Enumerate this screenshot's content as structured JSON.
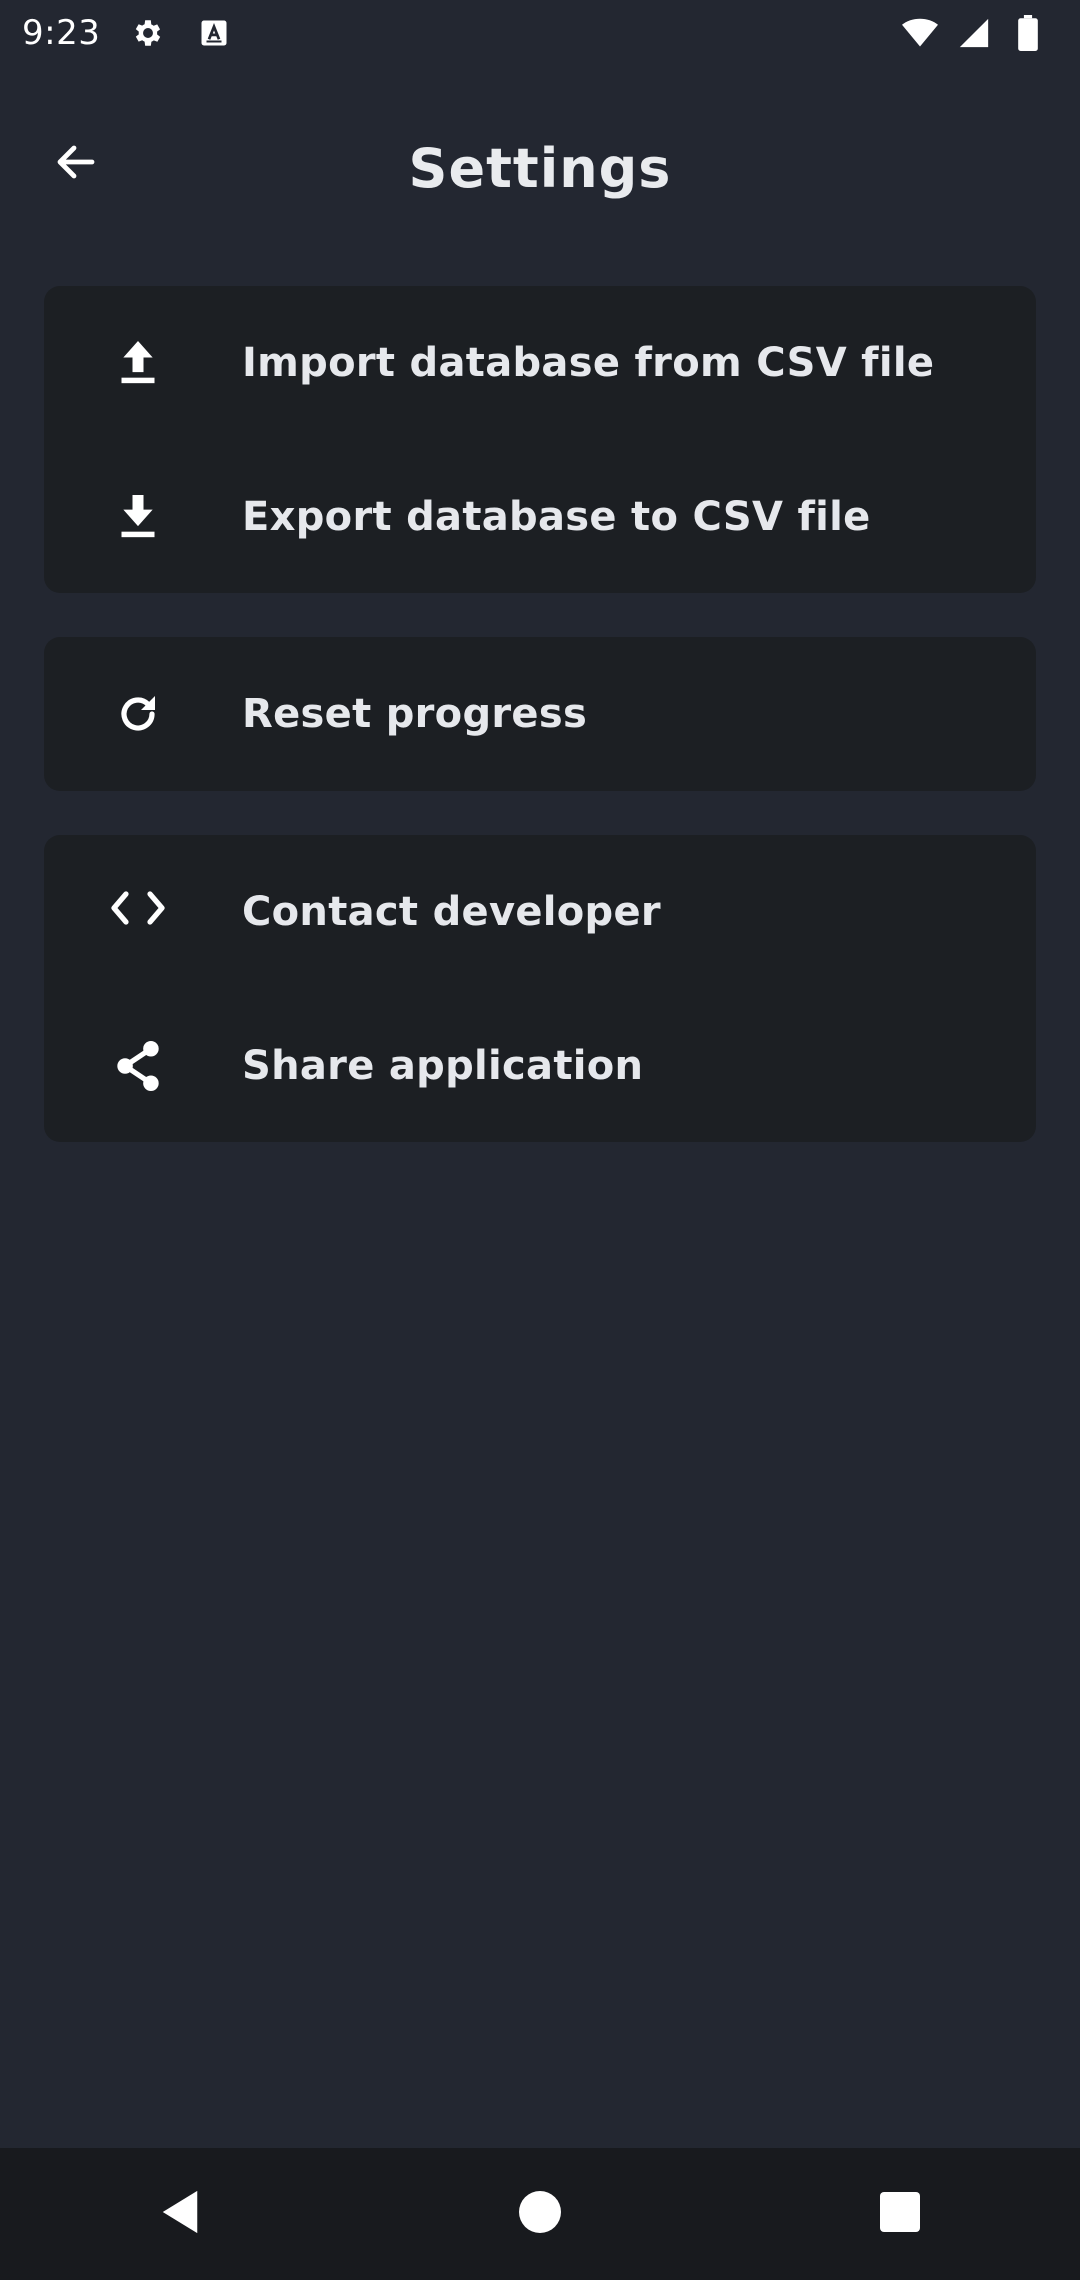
{
  "status_bar": {
    "time": "9:23",
    "icons": [
      "gear-icon",
      "a-icon",
      "wifi-icon",
      "signal-icon",
      "battery-icon"
    ]
  },
  "app_bar": {
    "title": "Settings",
    "back_icon": "arrow-back-icon"
  },
  "sections": [
    {
      "items": [
        {
          "label": "Import database from CSV file",
          "icon": "upload-icon"
        },
        {
          "label": "Export database to CSV file",
          "icon": "download-icon"
        }
      ]
    },
    {
      "items": [
        {
          "label": "Reset progress",
          "icon": "refresh-icon"
        }
      ]
    },
    {
      "items": [
        {
          "label": "Contact developer",
          "icon": "code-icon"
        },
        {
          "label": "Share application",
          "icon": "share-icon"
        }
      ]
    }
  ],
  "nav_bar": {
    "buttons": [
      "back-triangle-icon",
      "home-circle-icon",
      "recents-square-icon"
    ]
  },
  "colors": {
    "background": "#232731",
    "card": "#1c1f23",
    "nav_bar": "#181a1e",
    "text": "#e6e8ec"
  }
}
